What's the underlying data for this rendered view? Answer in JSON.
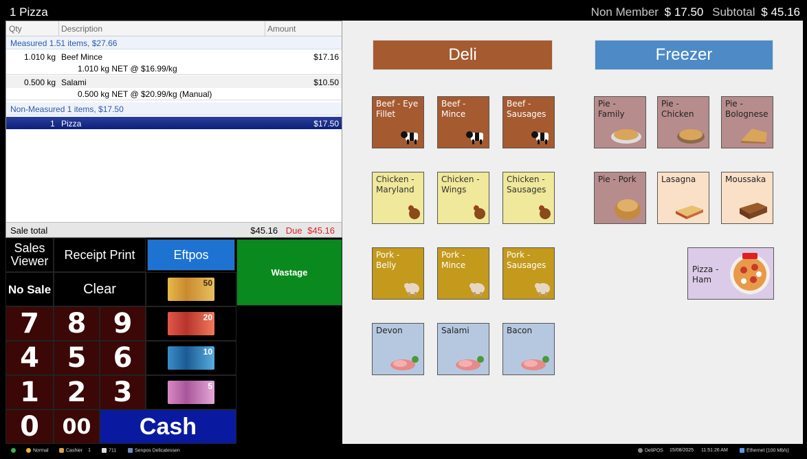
{
  "topbar": {
    "current_item": "1  Pizza",
    "member_label": "Non Member",
    "member_value": "$ 17.50",
    "subtotal_label": "Subtotal",
    "subtotal_value": "$ 45.16"
  },
  "receipt": {
    "columns": [
      "Qty",
      "Description",
      "Amount"
    ],
    "group1": "Measured 1.51 items, $27.66",
    "items": [
      {
        "qty": "1.010 kg",
        "desc": "Beef Mince",
        "amount": "$17.16",
        "detail": "1.010 kg NET @ $16.99/kg"
      },
      {
        "qty": "0.500 kg",
        "desc": "Salami",
        "amount": "$10.50",
        "detail": "0.500 kg NET @ $20.99/kg (Manual)"
      }
    ],
    "group2": "Non-Measured 1 items, $17.50",
    "selected": {
      "qty": "1",
      "desc": "Pizza",
      "amount": "$17.50"
    },
    "sale_total_label": "Sale total",
    "sale_total_value": "$45.16",
    "due_label": "Due",
    "due_value": "$45.16"
  },
  "keypad": {
    "sales_viewer": "Sales Viewer",
    "receipt_print": "Receipt Print",
    "eftpos": "Eftpos",
    "wastage": "Wastage",
    "no_sale": "No Sale",
    "clear": "Clear",
    "cash": "Cash",
    "digits": [
      "7",
      "8",
      "9",
      "4",
      "5",
      "6",
      "1",
      "2",
      "3",
      "0",
      "00"
    ],
    "notes": [
      "50",
      "20",
      "10",
      "5"
    ]
  },
  "categories": {
    "deli": "Deli",
    "freezer": "Freezer"
  },
  "tiles": {
    "beef_eye_fillet": "Beef - Eye Fillet",
    "beef_mince": "Beef - Mince",
    "beef_sausages": "Beef - Sausages",
    "chicken_maryland": "Chicken - Maryland",
    "chicken_wings": "Chicken - Wings",
    "chicken_sausages": "Chicken - Sausages",
    "pork_belly": "Pork - Belly",
    "pork_mince": "Pork - Mince",
    "pork_sausages": "Pork - Sausages",
    "devon": "Devon",
    "salami": "Salami",
    "bacon": "Bacon",
    "pie_family": "Pie - Family",
    "pie_chicken": "Pie - Chicken",
    "pie_bolognese": "Pie - Bolognese",
    "pie_pork": "Pie - Pork",
    "lasagna": "Lasagna",
    "moussaka": "Moussaka",
    "pizza_ham": "Pizza - Ham"
  },
  "status": {
    "mode": "Normal",
    "user": "Cashier",
    "user_id": "1",
    "doc": "711",
    "store": "Senpos Delicatessen",
    "app": "DeliPOS",
    "date": "15/08/2025",
    "time": "11:51:26 AM",
    "network": "Ethernet (100 Mb/s)"
  },
  "colors": {
    "eftpos": "#1e73d2",
    "wastage": "#0a8a1e",
    "cash": "#0a1aa0",
    "deli": "#a55a30",
    "freezer": "#4d8ac6"
  }
}
